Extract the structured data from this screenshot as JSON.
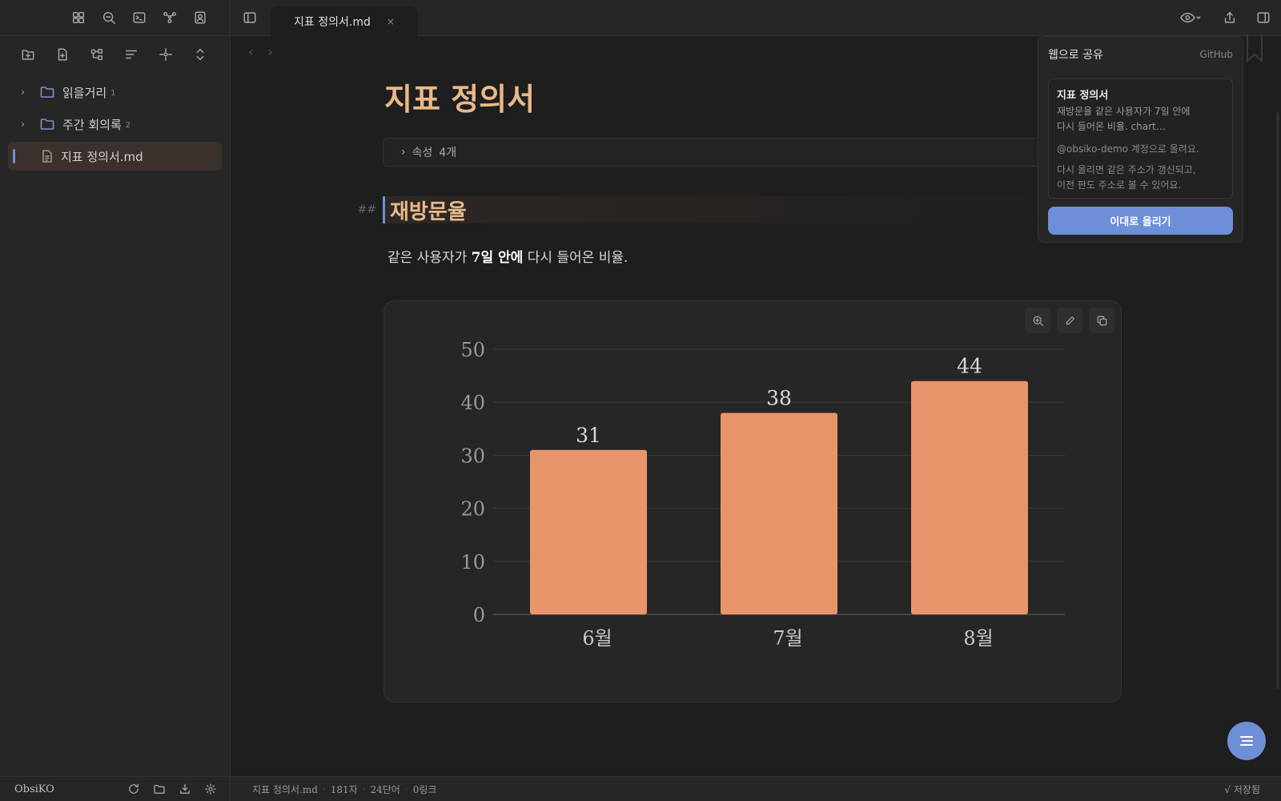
{
  "app": {
    "vault_name": "ObsiKO"
  },
  "sidebar": {
    "items": [
      {
        "type": "folder",
        "label": "읽을거리",
        "count": "1"
      },
      {
        "type": "folder",
        "label": "주간 회의록",
        "count": "2"
      },
      {
        "type": "file",
        "label": "지표 정의서.md"
      }
    ]
  },
  "tabs": [
    {
      "label": "지표 정의서.md",
      "close": "×"
    }
  ],
  "document": {
    "title": "지표 정의서",
    "properties_label": "속성",
    "properties_count": "4개",
    "heading_marker": "##",
    "heading": "재방문율",
    "para_before": "같은 사용자가 ",
    "para_bold": "7일 안에",
    "para_after": " 다시 들어온 비율."
  },
  "chart_data": {
    "type": "bar",
    "categories": [
      "6월",
      "7월",
      "8월"
    ],
    "values": [
      31,
      38,
      44
    ],
    "ylim": [
      0,
      50
    ],
    "yticks": [
      0,
      10,
      20,
      30,
      40,
      50
    ],
    "grid": true,
    "bar_color": "#e8956b",
    "data_labels": true
  },
  "share": {
    "title": "웹으로 공유",
    "provider": "GitHub",
    "doc_title": "지표 정의서",
    "doc_excerpt_1": "재방문율 같은 사용자가 7일 안에",
    "doc_excerpt_2": "다시 들어온 비율. chart…",
    "account": "@obsiko-demo 계정으로 올려요.",
    "note_1": "다시 올리면 같은 주소가 갱신되고,",
    "note_2": "이전 판도 주소로 볼 수 있어요.",
    "button": "이대로 올리기"
  },
  "status": {
    "file": "지표 정의서.md",
    "chars": "181자",
    "words": "24단어",
    "links": "0링크",
    "saved": "√ 저장됨"
  },
  "colors": {
    "accent": "#6d8fd8",
    "heading": "#e8b98a",
    "bar": "#e8956b"
  }
}
